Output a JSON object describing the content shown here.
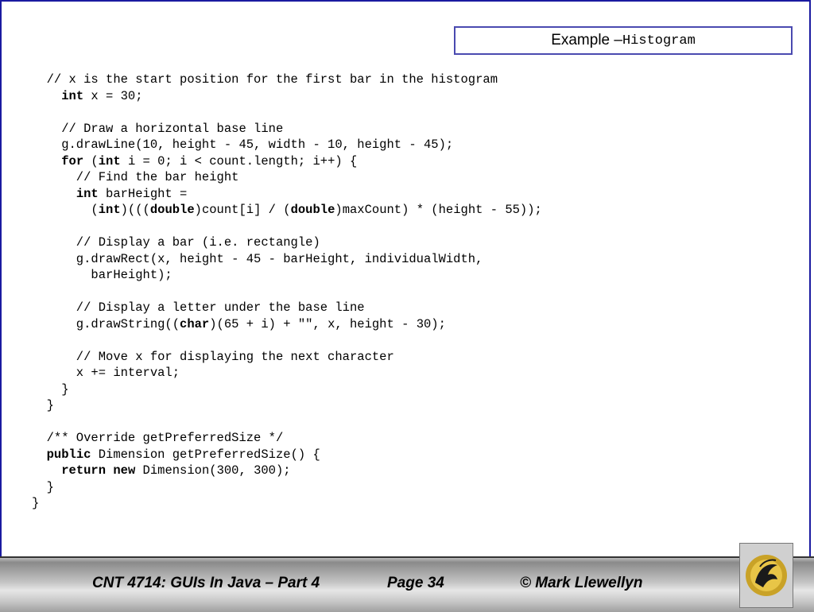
{
  "slide": {
    "title_prefix": "Example – ",
    "title_code": "Histogram"
  },
  "code_lines": [
    "  // x is the start position for the first bar in the histogram",
    "    int x = 30;",
    "",
    "    // Draw a horizontal base line",
    "    g.drawLine(10, height - 45, width - 10, height - 45);",
    "    for (int i = 0; i < count.length; i++) {",
    "      // Find the bar height",
    "      int barHeight =",
    "        (int)(((double)count[i] / (double)maxCount) * (height - 55));",
    "",
    "      // Display a bar (i.e. rectangle)",
    "      g.drawRect(x, height - 45 - barHeight, individualWidth,",
    "        barHeight);",
    "",
    "      // Display a letter under the base line",
    "      g.drawString((char)(65 + i) + \"\", x, height - 30);",
    "",
    "      // Move x for displaying the next character",
    "      x += interval;",
    "    }",
    "  }",
    "",
    "  /** Override getPreferredSize */",
    "  public Dimension getPreferredSize() {",
    "    return new Dimension(300, 300);",
    "  }",
    "}"
  ],
  "keywords": [
    "int",
    "for",
    "double",
    "char",
    "public",
    "return",
    "new"
  ],
  "footer": {
    "course": "CNT 4714:  GUIs In Java – Part 4",
    "page": "Page 34",
    "author": "© Mark Llewellyn"
  },
  "logo": {
    "icon": "pegasus-logo-icon"
  }
}
